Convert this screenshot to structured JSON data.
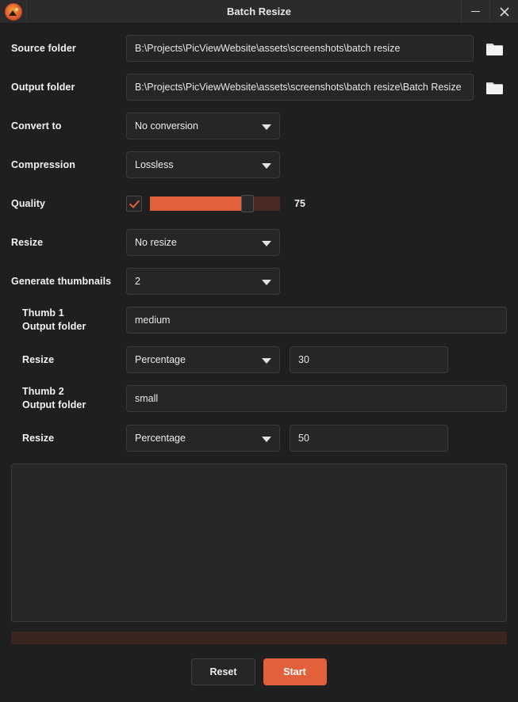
{
  "window": {
    "title": "Batch Resize",
    "app_icon": "picview-logo-icon",
    "minimize_label": "—",
    "close_label": "✕"
  },
  "form": {
    "source_folder": {
      "label": "Source folder",
      "value": "B:\\Projects\\PicViewWebsite\\assets\\screenshots\\batch resize",
      "browse_icon": "folder-icon"
    },
    "output_folder": {
      "label": "Output folder",
      "value": "B:\\Projects\\PicViewWebsite\\assets\\screenshots\\batch resize\\Batch Resize",
      "browse_icon": "folder-icon"
    },
    "convert_to": {
      "label": "Convert to",
      "value": "No conversion",
      "chevron_icon": "chevron-down-icon"
    },
    "compression": {
      "label": "Compression",
      "value": "Lossless",
      "chevron_icon": "chevron-down-icon"
    },
    "quality": {
      "label": "Quality",
      "enabled": true,
      "value": 75,
      "value_text": "75",
      "min": 0,
      "max": 100,
      "checkbox_icon": "check-icon"
    },
    "resize": {
      "label": "Resize",
      "value": "No resize",
      "chevron_icon": "chevron-down-icon"
    },
    "generate_thumbnails": {
      "label": "Generate thumbnails",
      "value": "2",
      "chevron_icon": "chevron-down-icon"
    },
    "thumbs": [
      {
        "title_line1": "Thumb  1",
        "title_line2": "Output folder",
        "folder_value": "medium",
        "resize_label": "Resize",
        "resize_mode": "Percentage",
        "resize_value": "30",
        "chevron_icon": "chevron-down-icon"
      },
      {
        "title_line1": "Thumb  2",
        "title_line2": "Output folder",
        "folder_value": "small",
        "resize_label": "Resize",
        "resize_mode": "Percentage",
        "resize_value": "50",
        "chevron_icon": "chevron-down-icon"
      }
    ]
  },
  "log": {
    "text": ""
  },
  "progress": {
    "percent": 0
  },
  "footer": {
    "reset_label": "Reset",
    "start_label": "Start"
  },
  "colors": {
    "accent": "#e2613a",
    "window_bg": "#1f1f1f",
    "field_bg": "#262626",
    "titlebar_bg": "#2b2b2b",
    "progress_track": "#3b2520"
  }
}
